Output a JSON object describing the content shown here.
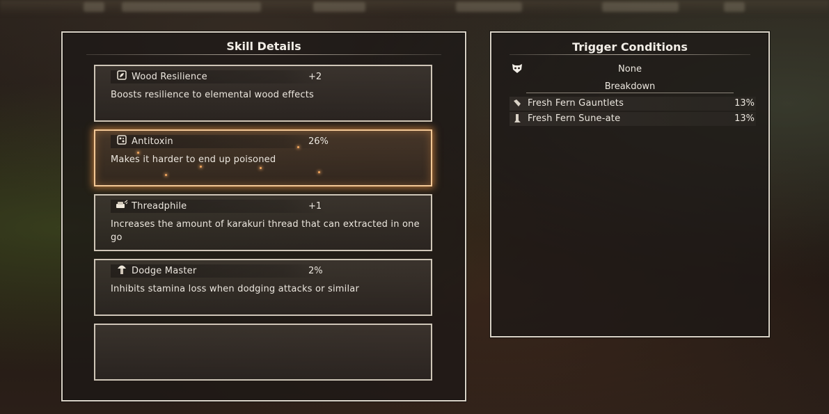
{
  "skill_details": {
    "title": "Skill Details",
    "skills": [
      {
        "name": "Wood Resilience",
        "value": "+2",
        "description": "Boosts resilience to elemental wood effects",
        "icon": "leaf-shield-icon",
        "selected": false
      },
      {
        "name": "Antitoxin",
        "value": "26%",
        "description": "Makes it harder to end up poisoned",
        "icon": "antitoxin-icon",
        "selected": true
      },
      {
        "name": "Threadphile",
        "value": "+1",
        "description": "Increases the amount of karakuri thread that can extracted in one go",
        "icon": "thread-icon",
        "selected": false
      },
      {
        "name": "Dodge Master",
        "value": "2%",
        "description": "Inhibits stamina loss when dodging attacks or similar",
        "icon": "mushroom-icon",
        "selected": false
      },
      {
        "name": "",
        "value": "",
        "description": "",
        "icon": "",
        "selected": false
      }
    ]
  },
  "trigger_conditions": {
    "title": "Trigger Conditions",
    "condition_icon": "beast-mask-icon",
    "condition_value": "None",
    "breakdown_label": "Breakdown",
    "breakdown": [
      {
        "name": "Fresh Fern Gauntlets",
        "percent": "13%",
        "icon": "gauntlets-icon"
      },
      {
        "name": "Fresh Fern Sune-ate",
        "percent": "13%",
        "icon": "greaves-icon"
      }
    ]
  },
  "colors": {
    "panel_border": "#d9d2c6",
    "selected_glow": "#f3c896",
    "text": "#ece7df"
  }
}
